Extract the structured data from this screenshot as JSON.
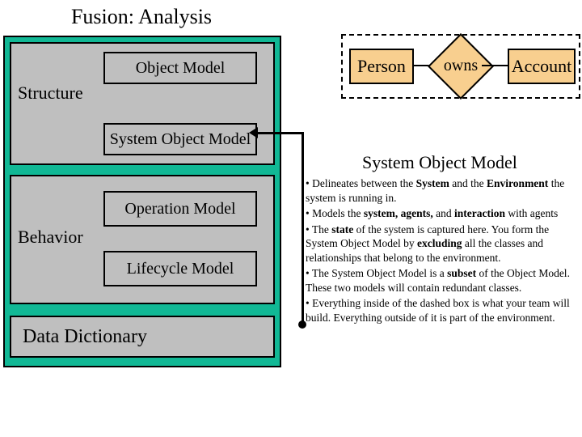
{
  "title": "Fusion: Analysis",
  "left": {
    "structure_label": "Structure",
    "object_model": "Object Model",
    "system_object_model": "System Object Model",
    "behavior_label": "Behavior",
    "operation_model": "Operation Model",
    "lifecycle_model": "Lifecycle Model",
    "data_dictionary": "Data Dictionary"
  },
  "diagram": {
    "person": "Person",
    "owns": "owns",
    "account": "Account"
  },
  "desc": {
    "heading": "System Object Model",
    "b1a": "• Delineates between the ",
    "b1b": "System",
    "b1c": " and the ",
    "b1d": "Environment",
    "b1e": " the system is running in.",
    "b2a": "• Models the ",
    "b2b": "system, agents,",
    "b2c": " and ",
    "b2d": "interaction",
    "b2e": " with agents",
    "b3a": "• The ",
    "b3b": "state",
    "b3c": " of the system is captured here. You form the System Object Model by ",
    "b3d": "excluding",
    "b3e": " all the classes and relationships that belong to the environment.",
    "b4a": "• The System Object Model is a ",
    "b4b": "subset",
    "b4c": " of the Object Model. These two models will contain redundant classes.",
    "b5": "• Everything inside of the dashed box is what your team will build. Everything outside of it is part of the environment."
  }
}
